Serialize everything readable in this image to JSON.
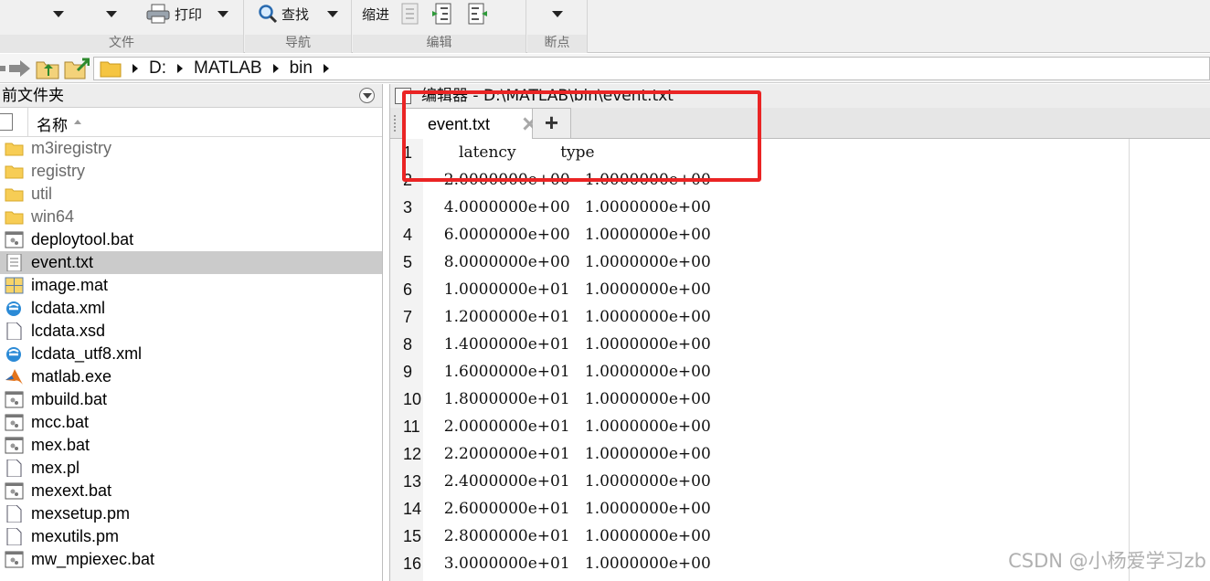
{
  "toolstrip": {
    "print_label": "打印",
    "find_label": "查找",
    "indent_label": "缩进",
    "sections": [
      "文件",
      "导航",
      "编辑",
      "断点"
    ]
  },
  "address": {
    "crumbs": [
      "D:",
      "MATLAB",
      "bin"
    ]
  },
  "folder": {
    "title": "前文件夹",
    "name_header": "名称",
    "items": [
      {
        "name": "m3iregistry",
        "icon": "folder-icon"
      },
      {
        "name": "registry",
        "icon": "folder-icon"
      },
      {
        "name": "util",
        "icon": "folder-icon"
      },
      {
        "name": "win64",
        "icon": "folder-icon"
      },
      {
        "name": "deploytool.bat",
        "icon": "bat-file-icon"
      },
      {
        "name": "event.txt",
        "icon": "text-file-icon",
        "selected": true
      },
      {
        "name": "image.mat",
        "icon": "mat-file-icon"
      },
      {
        "name": "lcdata.xml",
        "icon": "xml-file-icon"
      },
      {
        "name": "lcdata.xsd",
        "icon": "file-icon"
      },
      {
        "name": "lcdata_utf8.xml",
        "icon": "xml-file-icon"
      },
      {
        "name": "matlab.exe",
        "icon": "matlab-icon"
      },
      {
        "name": "mbuild.bat",
        "icon": "bat-file-icon"
      },
      {
        "name": "mcc.bat",
        "icon": "bat-file-icon"
      },
      {
        "name": "mex.bat",
        "icon": "bat-file-icon"
      },
      {
        "name": "mex.pl",
        "icon": "file-icon"
      },
      {
        "name": "mexext.bat",
        "icon": "bat-file-icon"
      },
      {
        "name": "mexsetup.pm",
        "icon": "file-icon"
      },
      {
        "name": "mexutils.pm",
        "icon": "file-icon"
      },
      {
        "name": "mw_mpiexec.bat",
        "icon": "bat-file-icon"
      }
    ]
  },
  "editor": {
    "title": "编辑器 - D:\\MATLAB\\bin\\event.txt",
    "tab_label": "event.txt",
    "add_tab_label": "+",
    "lines": [
      {
        "n": "1",
        "text": "     latency         type"
      },
      {
        "n": "2",
        "text": "  2.0000000e+00   1.0000000e+00"
      },
      {
        "n": "3",
        "text": "  4.0000000e+00   1.0000000e+00"
      },
      {
        "n": "4",
        "text": "  6.0000000e+00   1.0000000e+00"
      },
      {
        "n": "5",
        "text": "  8.0000000e+00   1.0000000e+00"
      },
      {
        "n": "6",
        "text": "  1.0000000e+01   1.0000000e+00"
      },
      {
        "n": "7",
        "text": "  1.2000000e+01   1.0000000e+00"
      },
      {
        "n": "8",
        "text": "  1.4000000e+01   1.0000000e+00"
      },
      {
        "n": "9",
        "text": "  1.6000000e+01   1.0000000e+00"
      },
      {
        "n": "10",
        "text": "  1.8000000e+01   1.0000000e+00"
      },
      {
        "n": "11",
        "text": "  2.0000000e+01   1.0000000e+00"
      },
      {
        "n": "12",
        "text": "  2.2000000e+01   1.0000000e+00"
      },
      {
        "n": "13",
        "text": "  2.4000000e+01   1.0000000e+00"
      },
      {
        "n": "14",
        "text": "  2.6000000e+01   1.0000000e+00"
      },
      {
        "n": "15",
        "text": "  2.8000000e+01   1.0000000e+00"
      },
      {
        "n": "16",
        "text": "  3.0000000e+01   1.0000000e+00"
      }
    ]
  },
  "watermark": "CSDN @小杨爱学习zb",
  "colors": {
    "highlight": "#ea2424",
    "selected_row": "#cbcbcb",
    "toolstrip_bg": "#f0f0f0"
  }
}
